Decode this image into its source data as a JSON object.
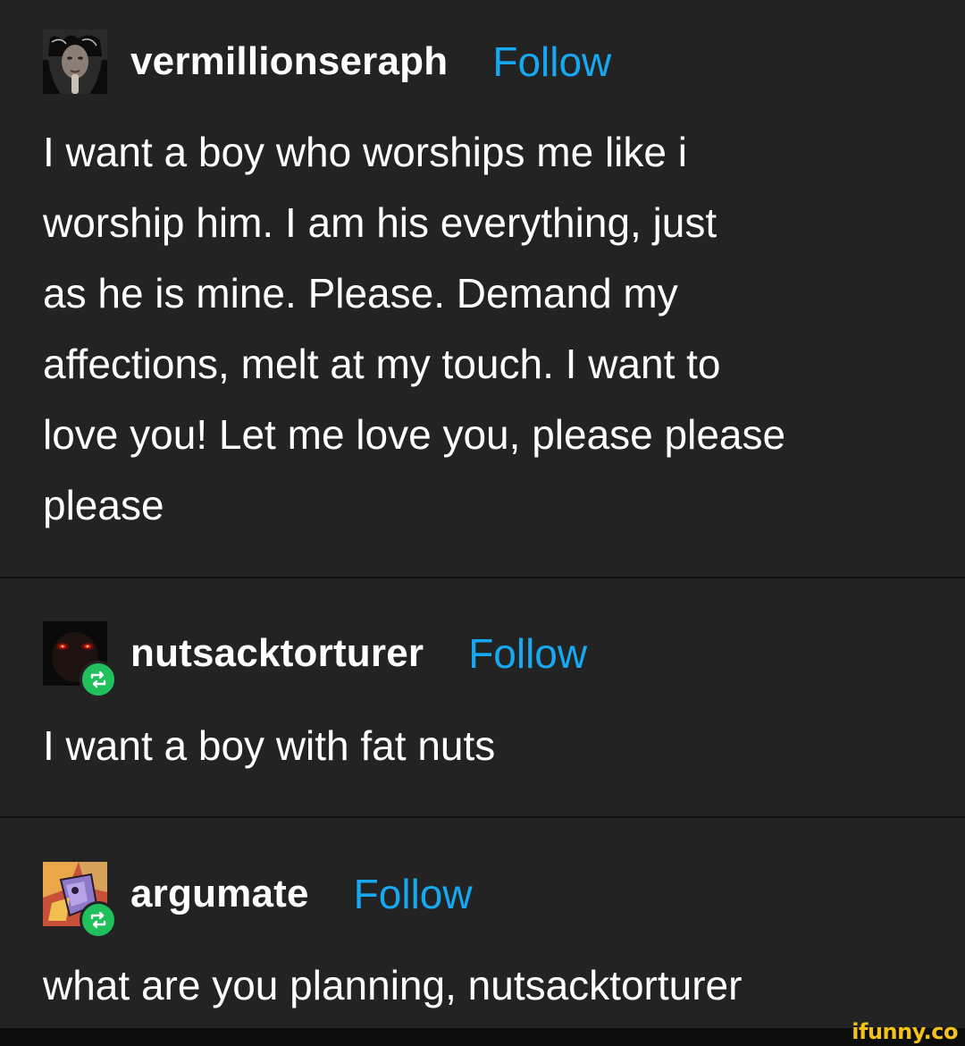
{
  "posts": [
    {
      "username": "vermillionseraph",
      "follow_label": "Follow",
      "avatar_icon": "portrait-avatar",
      "reblog": false,
      "lines": [
        "I want a boy who worships me like i",
        "worship him. I am his everything, just",
        "as he is mine. Please. Demand my",
        "affections, melt at my touch. I want to",
        "love you! Let me love you, please please",
        "please"
      ]
    },
    {
      "username": "nutsacktorturer",
      "follow_label": "Follow",
      "avatar_icon": "red-eyes-avatar",
      "reblog": true,
      "lines": [
        "I want a boy with fat nuts"
      ]
    },
    {
      "username": "argumate",
      "follow_label": "Follow",
      "avatar_icon": "abstract-face-avatar",
      "reblog": true,
      "lines": [
        "what are you planning, nutsacktorturer"
      ]
    }
  ],
  "watermark": "ifunny.co",
  "colors": {
    "background": "#232323",
    "follow": "#16a8f0",
    "reblog_badge": "#20c05c",
    "watermark": "#f2c21b"
  }
}
